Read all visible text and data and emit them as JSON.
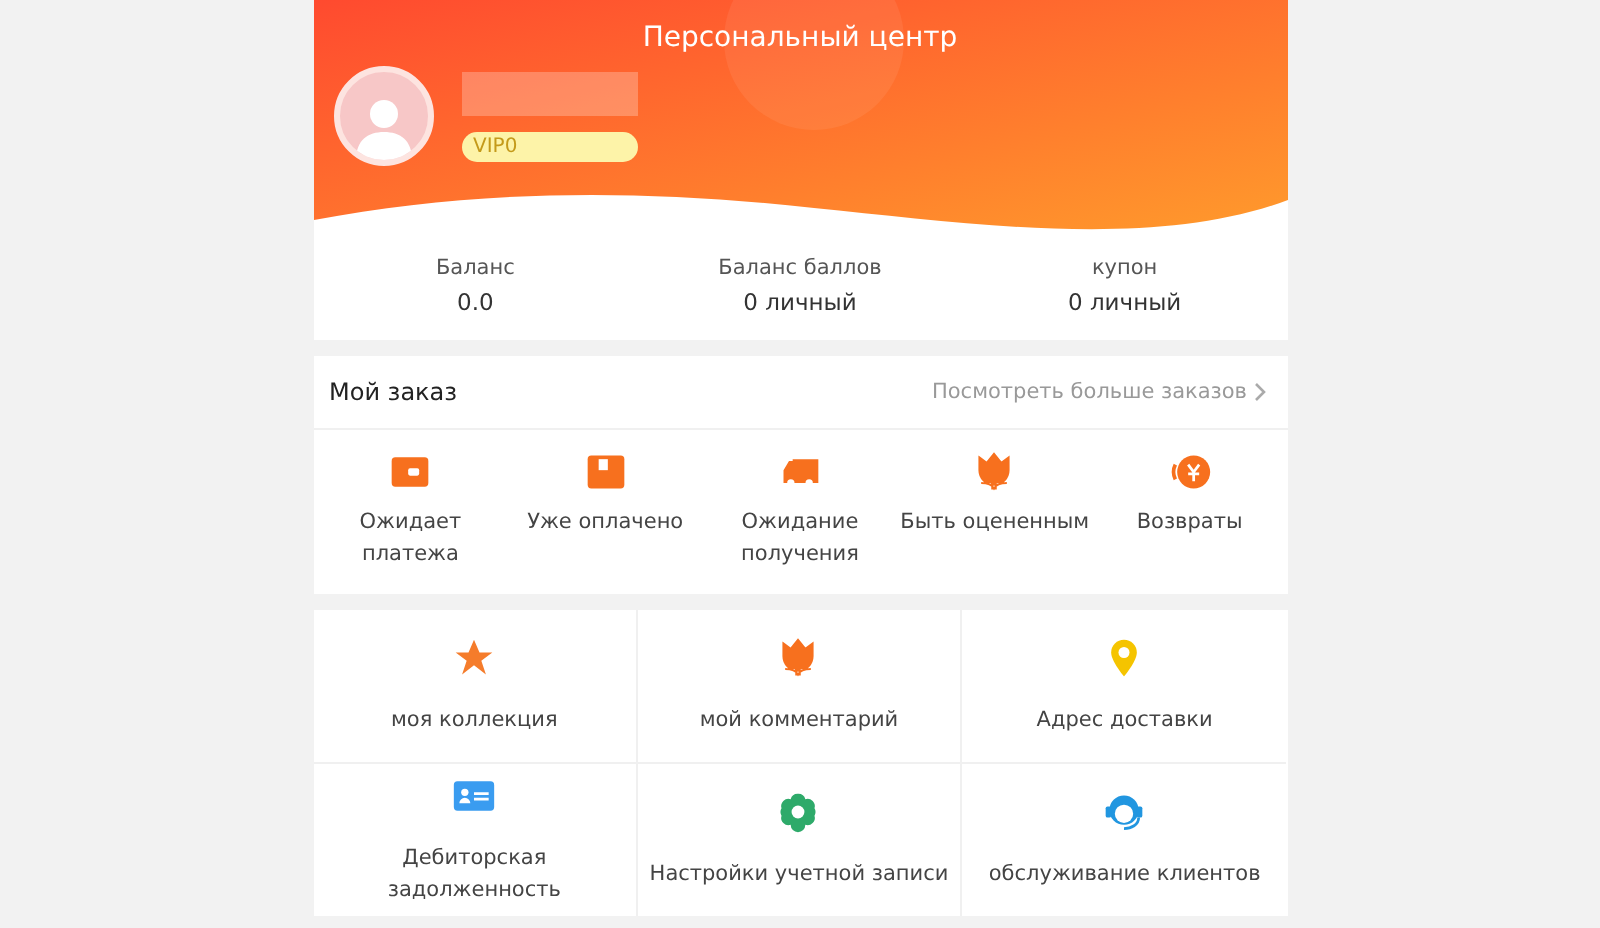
{
  "header": {
    "title": "Персональный центр",
    "badge": "VIP0"
  },
  "stats": [
    {
      "label": "Баланс",
      "value": "0.0"
    },
    {
      "label": "Баланс баллов",
      "value": "0 личный"
    },
    {
      "label": "купон",
      "value": "0 личный"
    }
  ],
  "orders": {
    "title": "Мой заказ",
    "more": "Посмотреть больше заказов",
    "items": [
      {
        "kind": "wallet",
        "label": "Ожидает платежа"
      },
      {
        "kind": "box",
        "label": "Уже оплачено"
      },
      {
        "kind": "truck",
        "label": "Ожидание получения"
      },
      {
        "kind": "tulip",
        "label": "Быть оцененным"
      },
      {
        "kind": "refund",
        "label": "Возвраты"
      }
    ]
  },
  "services": [
    {
      "kind": "star",
      "label": "моя коллекция"
    },
    {
      "kind": "tulip",
      "label": "мой комментарий"
    },
    {
      "kind": "pin",
      "label": "Адрес доставки"
    },
    {
      "kind": "card",
      "label": "Дебиторская задолженность"
    },
    {
      "kind": "gear",
      "label": "Настройки учетной записи"
    },
    {
      "kind": "headset",
      "label": "обслуживание клиентов"
    }
  ]
}
